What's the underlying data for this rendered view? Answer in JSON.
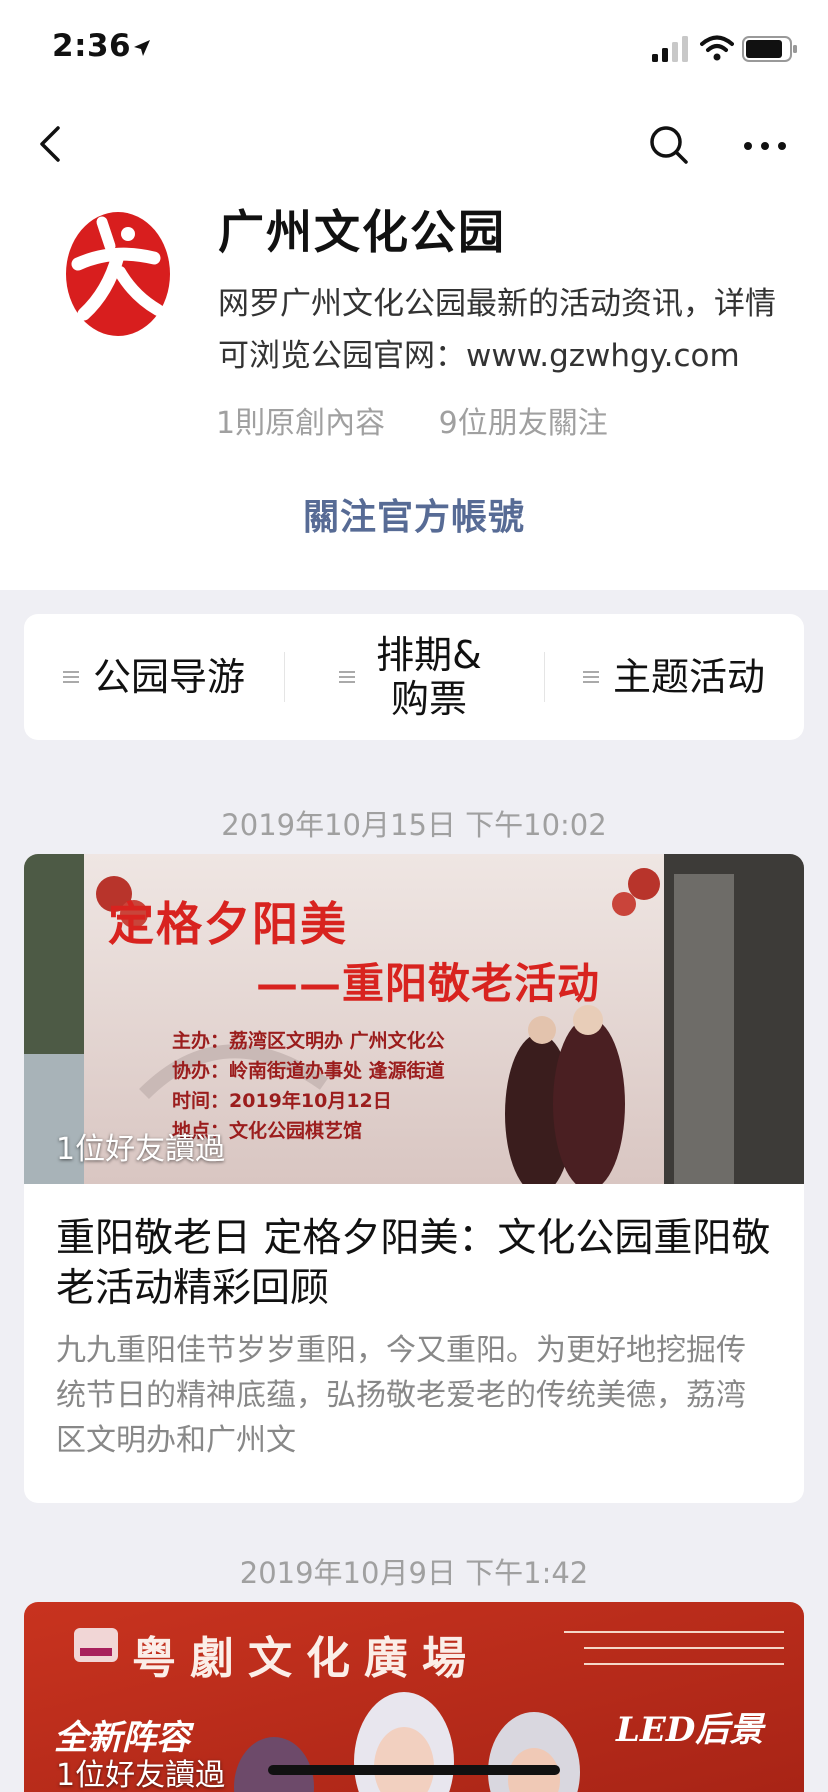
{
  "status_bar": {
    "time": "2:36"
  },
  "account": {
    "name": "广州文化公园",
    "description": "网罗广州文化公园最新的活动资讯，详情可浏览公园官网：www.gzwhgy.com",
    "original_count": "1則原創內容",
    "friends_following": "9位朋友關注",
    "follow_label": "關注官方帳號"
  },
  "menu": {
    "items": [
      {
        "label": "公园导游"
      },
      {
        "label": "排期&购票"
      },
      {
        "label": "主题活动"
      }
    ]
  },
  "feed": [
    {
      "date": "2019年10月15日 下午10:02",
      "read_badge": "1位好友讀過",
      "cover_headline": "定格夕阳美",
      "cover_subheadline": "——重阳敬老活动",
      "cover_info": [
        "主办：荔湾区文明办  广州文化公",
        "协办：岭南街道办事处  逢源街道",
        "时间：2019年10月12日",
        "地点：文化公园棋艺馆"
      ],
      "title": "重阳敬老日  定格夕阳美：文化公园重阳敬老活动精彩回顾",
      "digest": "九九重阳佳节岁岁重阳，今又重阳。为更好地挖掘传统节日的精神底蕴，弘扬敬老爱老的传统美德，荔湾区文明办和广州文"
    },
    {
      "date": "2019年10月9日 下午1:42",
      "read_badge": "1位好友讀過",
      "cover_headline": "粤劇文化廣場",
      "cover_tag1": "全新阵容",
      "cover_tag2": "LED后景"
    }
  ],
  "colors": {
    "link_blue": "#576b95",
    "logo_red": "#d81e1e",
    "page_bg": "#efeff4"
  },
  "icons": [
    "location-arrow-icon",
    "signal-icon",
    "wifi-icon",
    "battery-icon",
    "back-chevron-icon",
    "search-icon",
    "more-icon",
    "menu-list-icon"
  ]
}
